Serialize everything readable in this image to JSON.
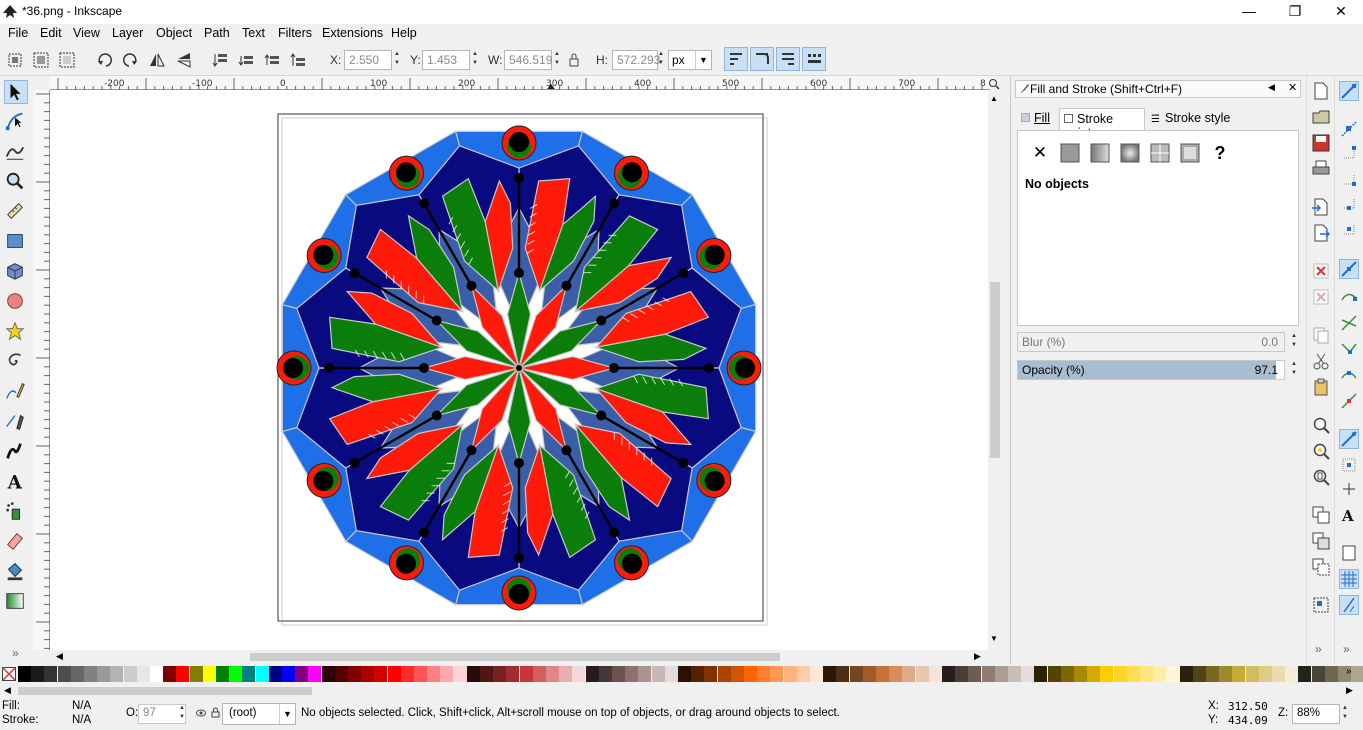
{
  "window": {
    "title": "*36.png - Inkscape",
    "minimize": "—",
    "maximize": "❐",
    "close": "✕"
  },
  "menu": [
    "File",
    "Edit",
    "View",
    "Layer",
    "Object",
    "Path",
    "Text",
    "Filters",
    "Extensions",
    "Help"
  ],
  "toolbar": {
    "x_label": "X:",
    "x_value": "2.550",
    "y_label": "Y:",
    "y_value": "1.453",
    "w_label": "W:",
    "w_value": "546.519",
    "h_label": "H:",
    "h_value": "572.293",
    "unit": "px"
  },
  "ruler_ticks": [
    "-200",
    "-100",
    "0",
    "100",
    "200",
    "300",
    "400",
    "500",
    "600",
    "700",
    "8"
  ],
  "dock": {
    "title": "Fill and Stroke (Shift+Ctrl+F)",
    "tab_fill": "Fill",
    "tab_stroke_paint": "Stroke paint",
    "tab_stroke_style": "Stroke style",
    "no_objects": "No objects",
    "blur_label": "Blur (%)",
    "blur_value": "0.0",
    "opacity_label": "Opacity (%)",
    "opacity_value": "97.1",
    "opacity_level": 0.97
  },
  "status": {
    "fill_label": "Fill:",
    "fill_value": "N/A",
    "stroke_label": "Stroke:",
    "stroke_value": "N/A",
    "o_label": "O:",
    "o_value": "97",
    "layer": "(root)",
    "message": "No objects selected. Click, Shift+click, Alt+scroll mouse on top of objects, or drag around objects to select.",
    "cursor_x_label": "X:",
    "cursor_x": "312.50",
    "cursor_y_label": "Y:",
    "cursor_y": "434.09",
    "zoom_label": "Z:",
    "zoom": "88%"
  },
  "colors": {
    "accent": "#c9dff5",
    "mandala_red": "#ff1a0a",
    "mandala_green": "#0a7d0a",
    "mandala_navy": "#0a0a80",
    "mandala_blue": "#1f6fe8",
    "mandala_steel": "#3a5fa8"
  },
  "palette_colors": [
    "#000000",
    "#1a1a1a",
    "#333333",
    "#4d4d4d",
    "#666666",
    "#808080",
    "#999999",
    "#b3b3b3",
    "#cccccc",
    "#e6e6e6",
    "#ffffff",
    "#800000",
    "#ff0000",
    "#808000",
    "#ffff00",
    "#008000",
    "#00ff00",
    "#008080",
    "#00ffff",
    "#000080",
    "#0000ff",
    "#800080",
    "#ff00ff",
    "#2b0000",
    "#550000",
    "#800000",
    "#aa0000",
    "#d40000",
    "#ff0000",
    "#ff2a2a",
    "#ff5555",
    "#ff8080",
    "#ffaaaa",
    "#ffd5d5",
    "#280b0b",
    "#501616",
    "#782121",
    "#a02c2c",
    "#c83737",
    "#d35f5f",
    "#de8787",
    "#e9afaf",
    "#f4d7d7",
    "#241c1c",
    "#483737",
    "#6c5353",
    "#916f6f",
    "#ac9393",
    "#c8b7b7",
    "#e3dbdb",
    "#2b1100",
    "#552200",
    "#803300",
    "#aa4400",
    "#d45500",
    "#ff6600",
    "#ff7f2a",
    "#ff9955",
    "#ffb380",
    "#ffccaa",
    "#ffe6d5",
    "#28170b",
    "#502d16",
    "#784421",
    "#a05a2c",
    "#c87137",
    "#d38d5f",
    "#deaa87",
    "#e9c6af",
    "#f4e3d7",
    "#241f1c",
    "#483e37",
    "#6c5d53",
    "#917c6f",
    "#ac9d93",
    "#c8beb7",
    "#e3dedb",
    "#2b2200",
    "#554400",
    "#806600",
    "#aa8800",
    "#d4aa00",
    "#ffcc00",
    "#ffd42a",
    "#ffdd55",
    "#ffe680",
    "#ffeeaa",
    "#fff6d5",
    "#28220b",
    "#504416",
    "#786721",
    "#a0892c",
    "#c8ab37",
    "#d3bc5f",
    "#decd87",
    "#e9ddaf",
    "#f4eed7",
    "#24221c",
    "#484537",
    "#6c6753",
    "#918a6f",
    "#aca793"
  ]
}
